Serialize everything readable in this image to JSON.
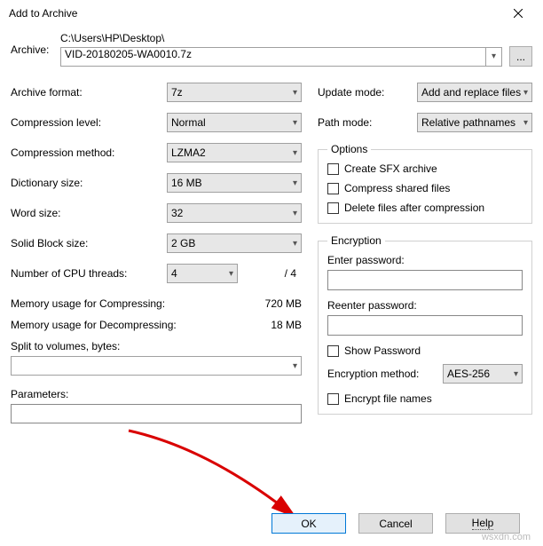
{
  "title": "Add to Archive",
  "archive": {
    "label": "Archive:",
    "path": "C:\\Users\\HP\\Desktop\\",
    "filename": "VID-20180205-WA0010.7z",
    "browse": "..."
  },
  "left": {
    "format_label": "Archive format:",
    "format_value": "7z",
    "level_label": "Compression level:",
    "level_value": "Normal",
    "method_label": "Compression method:",
    "method_value": "LZMA2",
    "dict_label": "Dictionary size:",
    "dict_value": "16 MB",
    "word_label": "Word size:",
    "word_value": "32",
    "block_label": "Solid Block size:",
    "block_value": "2 GB",
    "threads_label": "Number of CPU threads:",
    "threads_value": "4",
    "threads_max": "/ 4",
    "mem_comp_label": "Memory usage for Compressing:",
    "mem_comp_value": "720 MB",
    "mem_decomp_label": "Memory usage for Decompressing:",
    "mem_decomp_value": "18 MB",
    "split_label": "Split to volumes, bytes:",
    "params_label": "Parameters:"
  },
  "right": {
    "update_label": "Update mode:",
    "update_value": "Add and replace files",
    "pathmode_label": "Path mode:",
    "pathmode_value": "Relative pathnames",
    "options_legend": "Options",
    "opt_sfx": "Create SFX archive",
    "opt_shared": "Compress shared files",
    "opt_delete": "Delete files after compression",
    "enc_legend": "Encryption",
    "enter_pw": "Enter password:",
    "reenter_pw": "Reenter password:",
    "show_pw": "Show Password",
    "enc_method_label": "Encryption method:",
    "enc_method_value": "AES-256",
    "enc_names": "Encrypt file names"
  },
  "buttons": {
    "ok": "OK",
    "cancel": "Cancel",
    "help": "Help"
  },
  "watermark": "wsxdn.com"
}
